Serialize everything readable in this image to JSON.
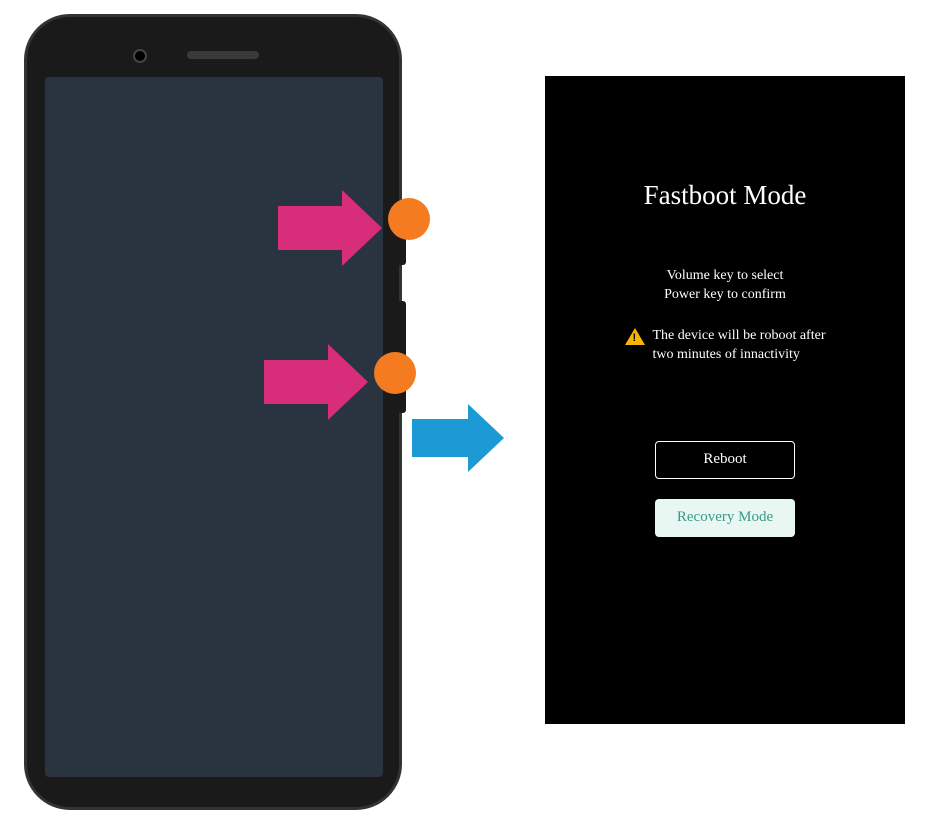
{
  "fastboot": {
    "title": "Fastboot Mode",
    "instruction_line1": "Volume key to select",
    "instruction_line2": "Power key to confirm",
    "warning_line1": "The device will be roboot after",
    "warning_line2": "two minutes of innactivity",
    "reboot_label": "Reboot",
    "recovery_label": "Recovery Mode"
  },
  "annotations": {
    "top_arrow": "press-button-arrow",
    "bottom_arrow": "press-button-arrow",
    "transition_arrow": "leads-to-arrow"
  }
}
